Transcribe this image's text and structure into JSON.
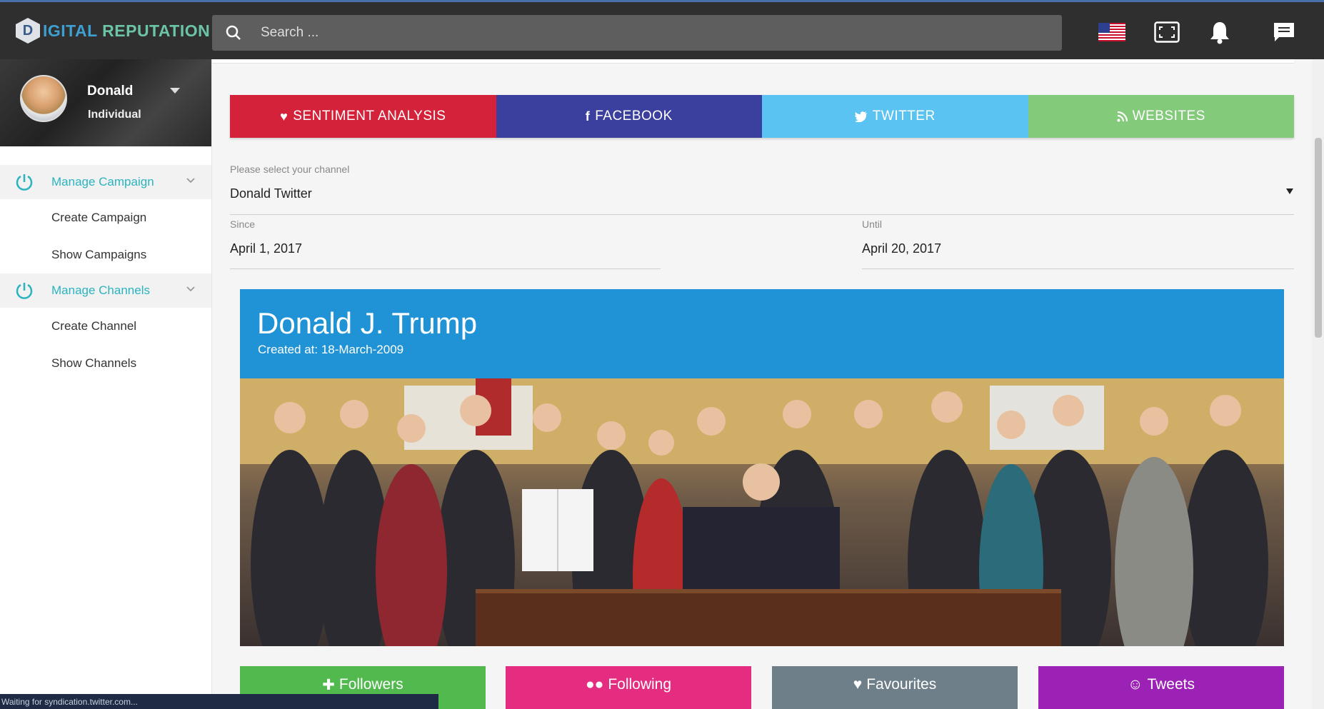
{
  "app": {
    "logo_letter": "D",
    "logo_part1": "IGITAL",
    "logo_part2": "REPUTATION"
  },
  "search": {
    "placeholder": "Search ..."
  },
  "top_icons": [
    "us-flag-icon",
    "fullscreen-icon",
    "bell-icon",
    "chat-icon"
  ],
  "profile": {
    "name": "Donald",
    "role": "Individual"
  },
  "sidebar": {
    "sections": [
      {
        "label": "Manage Campaign",
        "items": [
          "Create Campaign",
          "Show Campaigns"
        ]
      },
      {
        "label": "Manage Channels",
        "items": [
          "Create Channel",
          "Show Channels"
        ]
      }
    ]
  },
  "tabs": [
    {
      "label": "SENTIMENT ANALYSIS",
      "icon": "heart-icon",
      "color": "#d3223a"
    },
    {
      "label": "FACEBOOK",
      "icon": "facebook-icon",
      "color": "#3b3f9e"
    },
    {
      "label": "TWITTER",
      "icon": "twitter-icon",
      "color": "#5bc3f2"
    },
    {
      "label": "WEBSITES",
      "icon": "rss-icon",
      "color": "#83cb7a"
    }
  ],
  "filters": {
    "channel_label": "Please select your channel",
    "channel_value": "Donald Twitter",
    "since_label": "Since",
    "since_value": "April 1, 2017",
    "until_label": "Until",
    "until_value": "April 20, 2017"
  },
  "card": {
    "title": "Donald J. Trump",
    "created": "Created at: 18-March-2009",
    "header_color": "#1f93d6"
  },
  "stats": [
    {
      "label": "Followers",
      "icon": "users-plus-icon",
      "color": "#52b94f"
    },
    {
      "label": "Following",
      "icon": "users-icon",
      "color": "#e42d80"
    },
    {
      "label": "Favourites",
      "icon": "heart-icon",
      "color": "#6e7f8a"
    },
    {
      "label": "Tweets",
      "icon": "user-icon",
      "color": "#9c22b6"
    }
  ],
  "status_text": "Waiting for syndication.twitter.com..."
}
